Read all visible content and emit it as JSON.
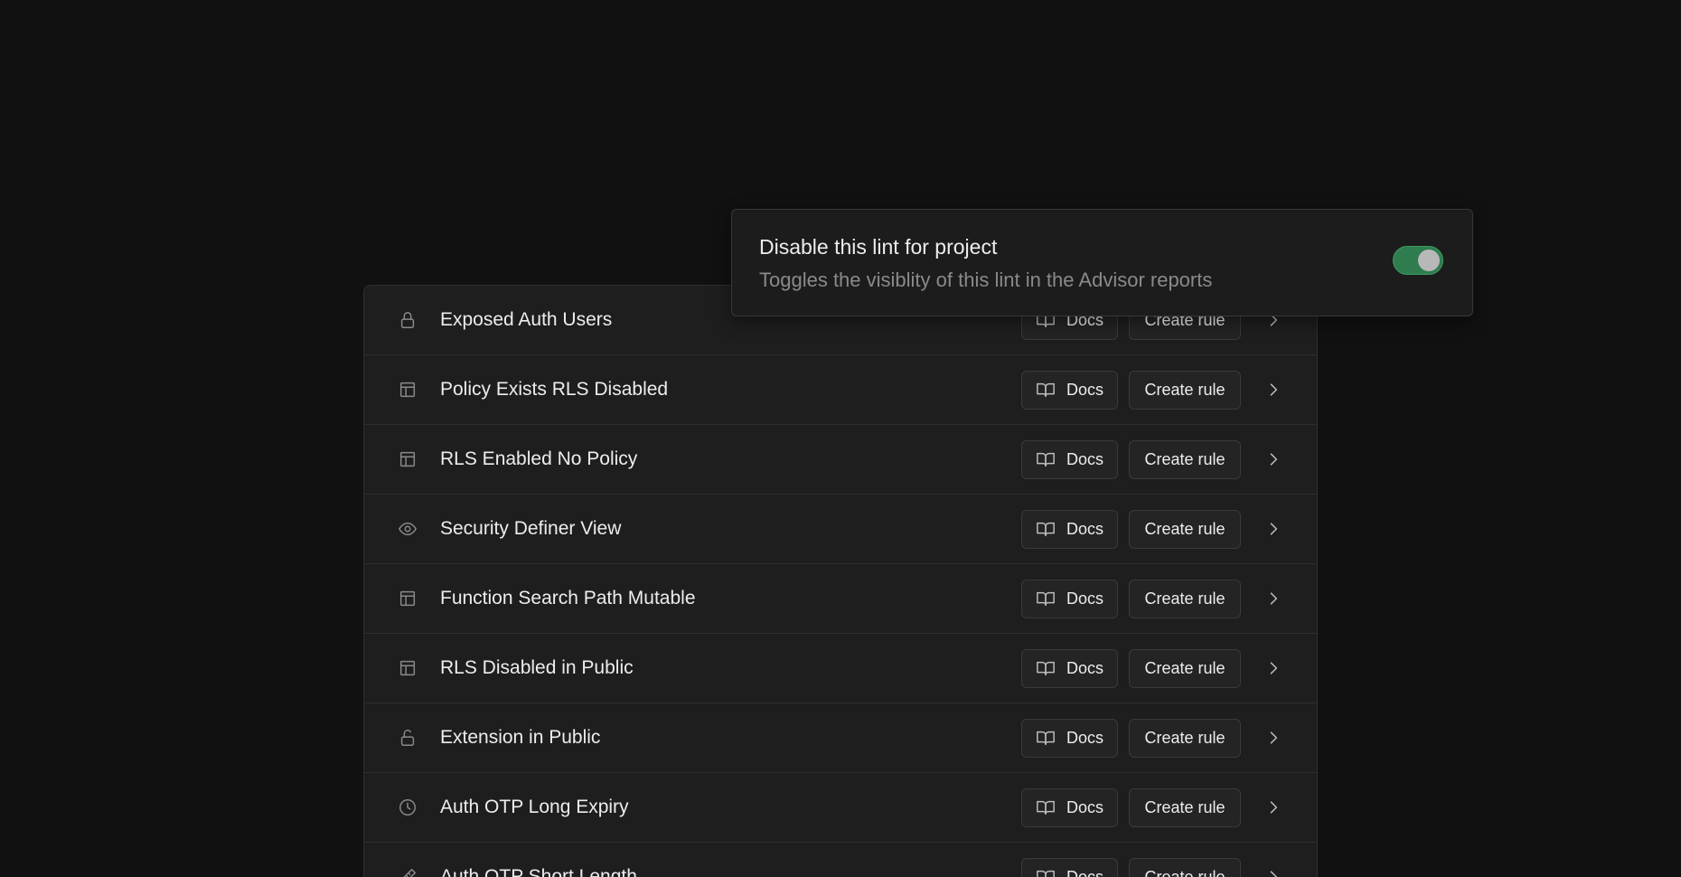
{
  "popover": {
    "title": "Disable this lint for project",
    "description": "Toggles the visiblity of this lint in the Advisor reports",
    "toggle_on": true,
    "toggle_color": "#2f7d4f"
  },
  "buttons": {
    "docs_label": "Docs",
    "create_rule_label": "Create rule"
  },
  "lints": [
    {
      "title": "Exposed Auth Users",
      "icon": "lock-icon"
    },
    {
      "title": "Policy Exists RLS Disabled",
      "icon": "table-icon"
    },
    {
      "title": "RLS Enabled No Policy",
      "icon": "table-icon"
    },
    {
      "title": "Security Definer View",
      "icon": "eye-icon"
    },
    {
      "title": "Function Search Path Mutable",
      "icon": "table-icon"
    },
    {
      "title": "RLS Disabled in Public",
      "icon": "table-icon"
    },
    {
      "title": "Extension in Public",
      "icon": "unlock-icon"
    },
    {
      "title": "Auth OTP Long Expiry",
      "icon": "clock-icon"
    },
    {
      "title": "Auth OTP Short Length",
      "icon": "ruler-icon"
    }
  ]
}
